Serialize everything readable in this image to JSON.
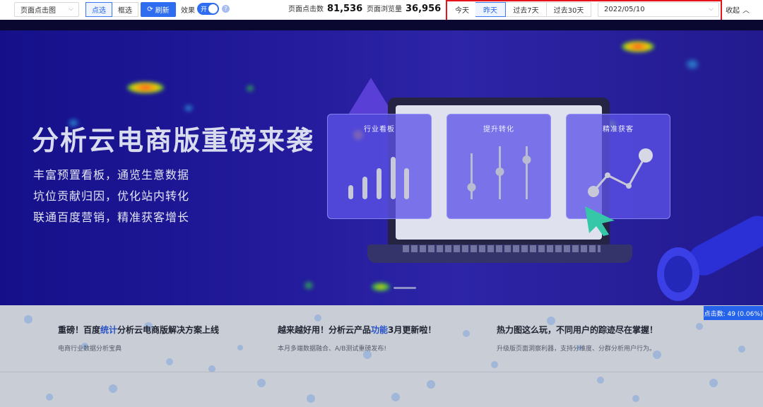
{
  "toolbar": {
    "page_view_select": "页面点击图",
    "mode_options": [
      "点选",
      "框选"
    ],
    "refresh_label": "刷新",
    "effect_label": "效果",
    "toggle_text": "开",
    "page_clicks_label": "页面点击数",
    "page_clicks_value": "81,536",
    "page_views_label": "页面浏览量",
    "page_views_value": "36,956",
    "date_ranges": [
      "今天",
      "昨天",
      "过去7天",
      "过去30天"
    ],
    "active_range": "昨天",
    "date_value": "2022/05/10",
    "collapse_label": "收起",
    "accent_color": "#2f6df0",
    "highlight_box_color": "#e5141b"
  },
  "banner": {
    "title": "分析云电商版重磅来袭",
    "lines": [
      "丰富预置看板，通览生意数据",
      "坑位贡献归因，优化站内转化",
      "联通百度营销，精准获客增长"
    ],
    "cards": [
      "行业看板",
      "提升转化",
      "精准获客"
    ]
  },
  "click_tip": "点击数: 49 (0.06%)",
  "news": [
    {
      "title_pre": "重磅！百度",
      "title_hl": "统计",
      "title_post": "分析云电商版解决方案上线",
      "subtitle": "电商行业数据分析宝典"
    },
    {
      "title_pre": "越来越好用！分析云产品",
      "title_hl": "功能",
      "title_post": "3月更新啦！",
      "subtitle": "本月多端数据融合、A/B测试重磅发布!"
    },
    {
      "title_pre": "热力图这么玩，不同用户的踪迹尽在掌握！",
      "title_hl": "",
      "title_post": "",
      "subtitle": "升级版页面洞察利器，支持分维度、分群分析用户行为。"
    }
  ]
}
